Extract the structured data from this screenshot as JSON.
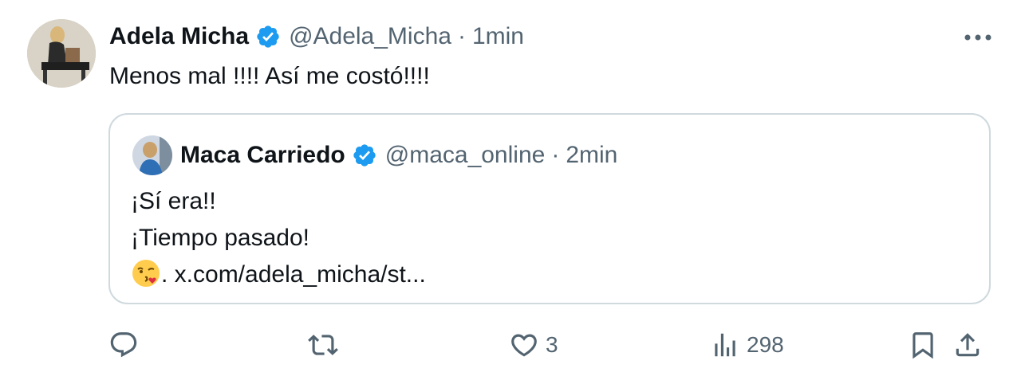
{
  "tweet": {
    "author_name": "Adela Micha",
    "author_handle": "@Adela_Micha",
    "separator": "·",
    "time": "1min",
    "text": "Menos mal !!!! Así me costó!!!!"
  },
  "quoted": {
    "author_name": "Maca Carriedo",
    "author_handle": "@maca_online",
    "separator": "·",
    "time": "2min",
    "lines": [
      "¡Sí era!!",
      "¡Tiempo pasado!"
    ],
    "link_text": ". x.com/adela_micha/st..."
  },
  "actions": {
    "reply_count": "",
    "retweet_count": "",
    "like_count": "3",
    "views_count": "298"
  },
  "colors": {
    "verified_blue": "#1d9bf0",
    "secondary_text": "#536471",
    "border": "#cfd9de"
  },
  "icons": [
    "more-icon",
    "verified-badge-icon",
    "reply-icon",
    "retweet-icon",
    "like-icon",
    "views-icon",
    "bookmark-icon",
    "share-icon",
    "kissing-face-emoji"
  ]
}
